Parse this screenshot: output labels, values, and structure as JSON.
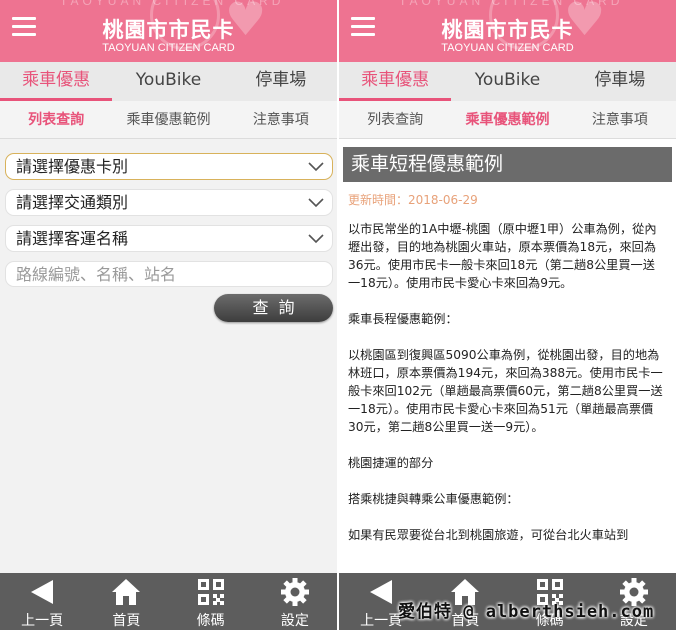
{
  "app": {
    "title": "桃園市市民卡",
    "subtitle": "TAOYUAN CITIZEN CARD",
    "faint_text": "TAOYUAN CITIZEN CARD"
  },
  "main_tabs": [
    {
      "label": "乘車優惠"
    },
    {
      "label": "YouBike"
    },
    {
      "label": "停車場"
    }
  ],
  "sub_tabs": [
    {
      "label": "列表查詢"
    },
    {
      "label": "乘車優惠範例"
    },
    {
      "label": "注意事項"
    }
  ],
  "left": {
    "selects": [
      {
        "value": "請選擇優惠卡別"
      },
      {
        "value": "請選擇交通類別"
      },
      {
        "value": "請選擇客運名稱"
      }
    ],
    "search_placeholder": "路線編號、名稱、站名",
    "query_button": "查詢"
  },
  "right": {
    "section_title": "乘車短程優惠範例",
    "update_text": "更新時間：2018-06-29",
    "paragraphs": [
      "以市民常坐的1A中壢-桃園（原中壢1甲）公車為例，從內壢出發，目的地為桃園火車站，原本票價為18元，來回為36元。使用市民卡一般卡來回18元（第二趟8公里買一送一18元）。使用市民卡愛心卡來回為9元。",
      "乘車長程優惠範例：",
      "以桃園區到復興區5090公車為例，從桃園出發，目的地為林班口，原本票價為194元，來回為388元。使用市民卡一般卡來回102元（單趟最高票價60元，第二趟8公里買一送一18元）。使用市民卡愛心卡來回為51元（單趟最高票價30元，第二趟8公里買一送一9元）。",
      "桃園捷運的部分",
      "搭乘桃捷與轉乘公車優惠範例：",
      "如果有民眾要從台北到桃園旅遊，可從台北火車站到"
    ]
  },
  "bottom_nav": [
    {
      "label": "上一頁",
      "icon": "back-arrow-icon"
    },
    {
      "label": "首頁",
      "icon": "home-icon"
    },
    {
      "label": "條碼",
      "icon": "qr-code-icon"
    },
    {
      "label": "設定",
      "icon": "gear-icon"
    }
  ],
  "watermark": "愛伯特 @ alberthsieh.com",
  "colors": {
    "header": "#ee7391",
    "accent": "#e8537a",
    "section_title_bg": "#6b6b6b",
    "bottom_bar": "#5d5d5d",
    "update_text": "#e8a27a"
  }
}
